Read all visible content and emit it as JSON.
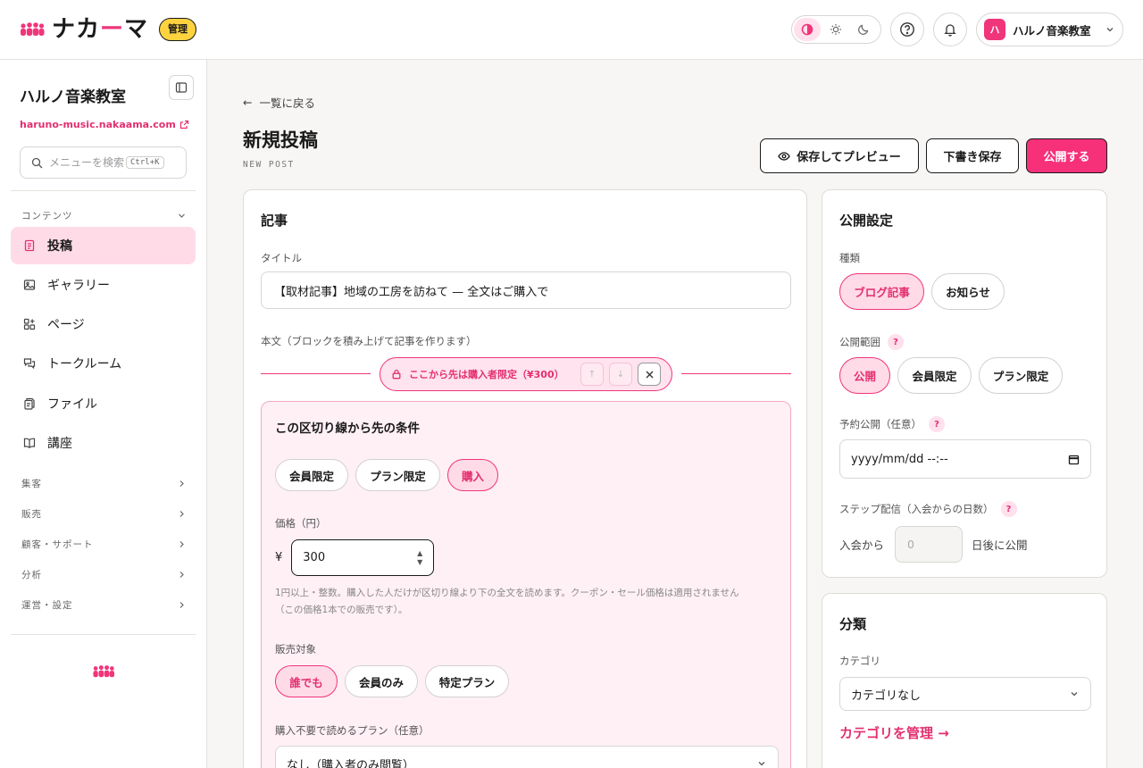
{
  "topbar": {
    "logo_text_a": "ナカ",
    "logo_text_dash": "ー",
    "logo_text_b": "マ",
    "admin_badge": "管理",
    "account_avatar": "ハ",
    "account_name": "ハルノ音楽教室"
  },
  "sidebar": {
    "org_name": "ハルノ音楽教室",
    "org_url": "haruno-music.nakaama.com",
    "search_placeholder": "メニューを検索",
    "search_shortcut": "Ctrl+K",
    "content_section": "コンテンツ",
    "items": [
      {
        "label": "投稿",
        "icon": "document-icon"
      },
      {
        "label": "ギャラリー",
        "icon": "image-icon"
      },
      {
        "label": "ページ",
        "icon": "pages-icon"
      },
      {
        "label": "トークルーム",
        "icon": "chat-icon"
      },
      {
        "label": "ファイル",
        "icon": "file-icon"
      },
      {
        "label": "講座",
        "icon": "book-icon"
      }
    ],
    "groups": [
      "集客",
      "販売",
      "顧客・サポート",
      "分析",
      "運営・設定"
    ]
  },
  "main": {
    "back_link": "一覧に戻る",
    "title": "新規投稿",
    "subtitle": "NEW POST",
    "buttons": {
      "preview": "保存してプレビュー",
      "draft": "下書き保存",
      "publish": "公開する"
    },
    "article": {
      "card_title": "記事",
      "title_label": "タイトル",
      "title_value": "【取材記事】地域の工房を訪ねて — 全文はご購入で",
      "body_label": "本文（ブロックを積み上げて記事を作ります）",
      "paywall_text": "ここから先は購入者限定（¥300）",
      "conditions": {
        "title": "この区切り線から先の条件",
        "options": [
          "会員限定",
          "プラン限定",
          "購入"
        ],
        "selected": "購入",
        "price_label": "価格（円）",
        "currency": "¥",
        "price_value": "300",
        "help_line1": "1円以上・整数。購入した人だけが区切り線より下の全文を読めます。クーポン・セール価格は適用されません",
        "help_line2": "（この価格1本での販売です）。",
        "target_label": "販売対象",
        "targets": [
          "誰でも",
          "会員のみ",
          "特定プラン"
        ],
        "target_selected": "誰でも",
        "free_plan_label": "購入不要で読めるプラン（任意）",
        "free_plan_value": "なし（購入者のみ閲覧）"
      }
    },
    "publish_settings": {
      "card_title": "公開設定",
      "type_label": "種類",
      "types": [
        "ブログ記事",
        "お知らせ"
      ],
      "type_selected": "ブログ記事",
      "scope_label": "公開範囲",
      "scopes": [
        "公開",
        "会員限定",
        "プラン限定"
      ],
      "scope_selected": "公開",
      "schedule_label": "予約公開（任意）",
      "schedule_placeholder": "yyyy/mm/dd --:--",
      "step_label": "ステップ配信（入会からの日数）",
      "step_prefix": "入会から",
      "step_value": "0",
      "step_suffix": "日後に公開",
      "help": "?"
    },
    "category": {
      "card_title": "分類",
      "label": "カテゴリ",
      "value": "カテゴリなし",
      "manage_link": "カテゴリを管理 →"
    }
  },
  "colors": {
    "accent": "#f0357a",
    "accent_soft": "#ffdbe8",
    "badge": "#ffd23f"
  }
}
